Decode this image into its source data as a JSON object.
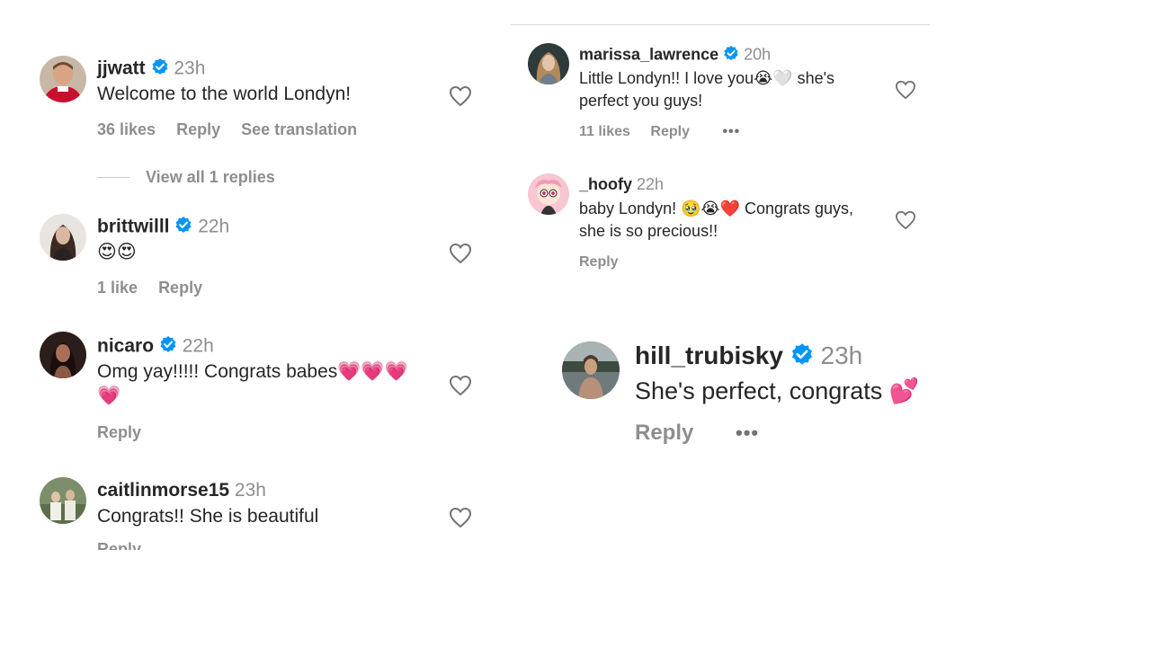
{
  "left": {
    "comments": [
      {
        "username": "jjwatt",
        "verified": true,
        "time": "23h",
        "text": "Welcome to the world Londyn!",
        "likes": "36 likes",
        "reply": "Reply",
        "translation": "See translation",
        "view_replies": "View all 1 replies"
      },
      {
        "username": "brittwilll",
        "verified": true,
        "time": "22h",
        "text": "😍😍",
        "likes": "1 like",
        "reply": "Reply"
      },
      {
        "username": "nicaro",
        "verified": true,
        "time": "22h",
        "text_line1": "Omg yay!!!!! Congrats babes💗💗💗",
        "text_line2": "💗",
        "reply": "Reply"
      },
      {
        "username": "caitlinmorse15",
        "verified": false,
        "time": "23h",
        "text": "Congrats!! She is beautiful",
        "reply": "Reply"
      }
    ]
  },
  "right": {
    "comments": [
      {
        "username": "marissa_lawrence",
        "verified": true,
        "time": "20h",
        "text_line1": "Little Londyn!! I love you😭🤍 she's",
        "text_line2": "perfect you guys!",
        "likes": "11 likes",
        "reply": "Reply",
        "more": "•••"
      },
      {
        "username": "_hoofy",
        "verified": false,
        "time": "22h",
        "text_line1": "baby Londyn! 🥹😭❤️ Congrats guys,",
        "text_line2": "she is so precious!!",
        "reply": "Reply"
      }
    ]
  },
  "featured": {
    "username": "hill_trubisky",
    "verified": true,
    "time": "23h",
    "text": "She's perfect, congrats 💕",
    "reply": "Reply",
    "more": "•••"
  },
  "colors": {
    "verified_blue": "#0095f6",
    "meta_gray": "#8e8e8e",
    "text_dark": "#262626"
  }
}
